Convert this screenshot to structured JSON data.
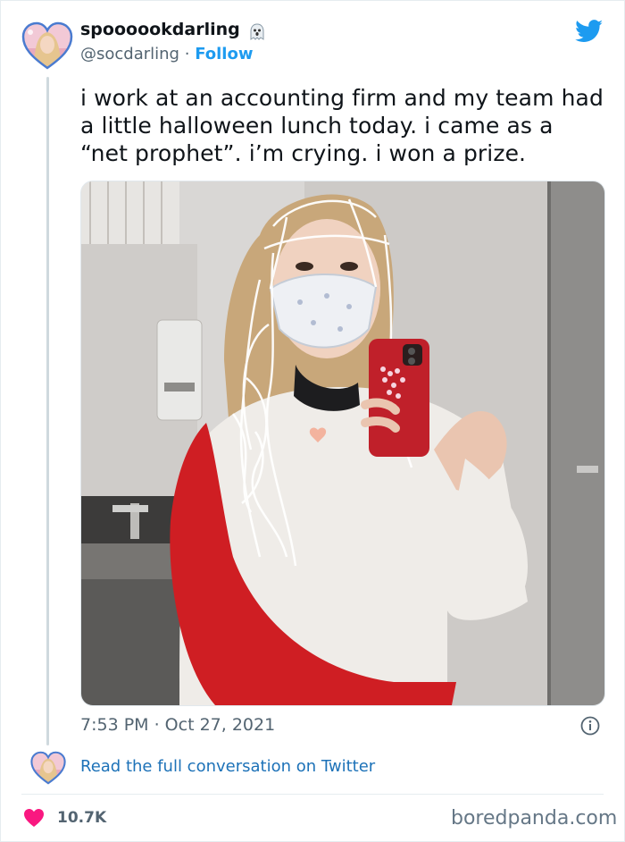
{
  "user": {
    "display_name": "spoooookdarling",
    "handle": "@socdarling",
    "separator": "·",
    "follow_label": "Follow"
  },
  "tweet": {
    "text": "i work at an accounting firm and my team had a little halloween lunch today. i came as a “net prophet”. i’m crying. i won a prize.",
    "timestamp": "7:53 PM · Oct 27, 2021"
  },
  "conversation": {
    "link_text": "Read the full conversation on Twitter"
  },
  "engagement": {
    "like_count": "10.7K"
  },
  "watermark": "boredpanda.com",
  "colors": {
    "brand_blue": "#1d9bf0",
    "link_blue": "#1d72b8",
    "like_pink": "#f91880",
    "avatar_border": "#4a7bd0",
    "secondary_text": "#536471"
  },
  "icons": [
    "avatar",
    "ghost-icon",
    "twitter-bird-icon",
    "info-icon",
    "heart-icon"
  ]
}
